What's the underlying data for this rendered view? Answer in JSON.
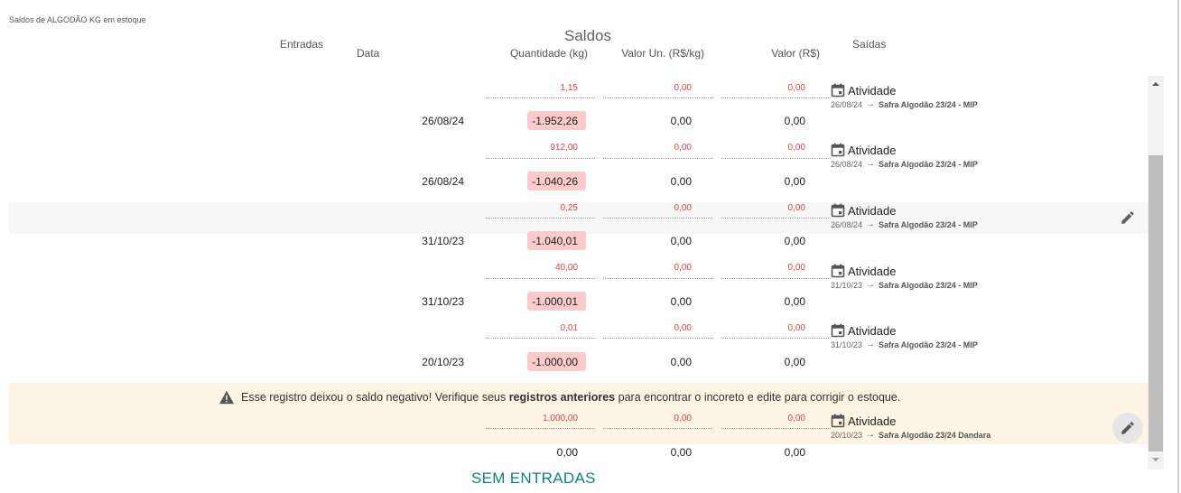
{
  "page": {
    "caption": "Saldos de ALGODÃO KG em estoque"
  },
  "headers": {
    "saldos": "Saldos",
    "entradas": "Entradas",
    "data": "Data",
    "quantidade": "Quantidade (kg)",
    "valor_un": "Valor Un. (R$/kg)",
    "valor": "Valor (R$)",
    "saidas": "Saídas"
  },
  "rows": [
    {
      "sub": {
        "qty": "1,15",
        "unit": "0,00",
        "value": "0,00"
      },
      "date": "26/08/24",
      "qty": "-1.952,26",
      "unit": "0,00",
      "value": "0,00",
      "activity": {
        "title": "Atividade",
        "date": "26/08/24",
        "target": "Safra Algodão 23/24 - MIP"
      }
    },
    {
      "sub": {
        "qty": "912,00",
        "unit": "0,00",
        "value": "0,00"
      },
      "date": "26/08/24",
      "qty": "-1.040,26",
      "unit": "0,00",
      "value": "0,00",
      "activity": {
        "title": "Atividade",
        "date": "26/08/24",
        "target": "Safra Algodão 23/24 - MIP"
      }
    },
    {
      "sub": {
        "qty": "0,25",
        "unit": "0,00",
        "value": "0,00"
      },
      "date": "31/10/23",
      "qty": "-1.040,01",
      "unit": "0,00",
      "value": "0,00",
      "activity": {
        "title": "Atividade",
        "date": "26/08/24",
        "target": "Safra Algodão 23/24 - MIP"
      }
    },
    {
      "sub": {
        "qty": "40,00",
        "unit": "0,00",
        "value": "0,00"
      },
      "date": "31/10/23",
      "qty": "-1.000,01",
      "unit": "0,00",
      "value": "0,00",
      "activity": {
        "title": "Atividade",
        "date": "31/10/23",
        "target": "Safra Algodão 23/24 - MIP"
      }
    },
    {
      "sub": {
        "qty": "0,01",
        "unit": "0,00",
        "value": "0,00"
      },
      "date": "20/10/23",
      "qty": "-1.000,00",
      "unit": "0,00",
      "value": "0,00",
      "activity": {
        "title": "Atividade",
        "date": "31/10/23",
        "target": "Safra Algodão 23/24 - MIP"
      }
    },
    {
      "sub": {
        "qty": "1.000,00",
        "unit": "0,00",
        "value": "0,00"
      },
      "activity": {
        "title": "Atividade",
        "date": "20/10/23",
        "target": "Safra Algodão 23/24 Dandara"
      }
    }
  ],
  "warning": {
    "before": "Esse registro deixou o saldo negativo! Verifique seus",
    "bold": "registros anteriores",
    "after": "para encontrar o incoreto e edite para corrigir o estoque."
  },
  "totals": {
    "qty": "0,00",
    "unit": "0,00",
    "value": "0,00"
  },
  "empty_state": "SEM ENTRADAS",
  "icons": {
    "calendar": "calendar-icon",
    "arrow": "arrow-right-icon",
    "edit": "pencil-icon",
    "warning": "warning-triangle-icon"
  },
  "colors": {
    "negative_highlight": "#fbcaca",
    "sub_value": "#d64545",
    "warning_bg": "#fdf4e4",
    "empty_state": "#13807b"
  }
}
